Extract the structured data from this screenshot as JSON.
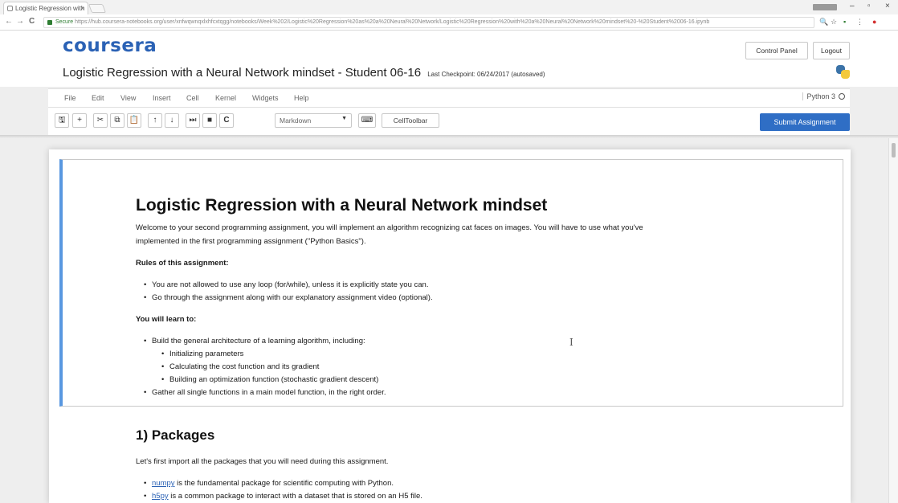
{
  "browser": {
    "tab_title": "Logistic Regression with",
    "tab_close": "×",
    "back": "←",
    "forward": "→",
    "reload": "C",
    "secure_label": "Secure",
    "url": "https://hub.coursera-notebooks.org/user/xnfwqwnqxlxhfcxtqgg/notebooks/Week%202/Logistic%20Regression%20as%20a%20Neural%20Network/Logistic%20Regression%20with%20a%20Neural%20Network%20mindset%20-%20Student%2006-16.ipynb",
    "window_minimize": "–",
    "window_restore": "▫",
    "window_close": "×"
  },
  "header": {
    "logo": "coursera",
    "notebook_title": "Logistic Regression with a Neural Network mindset - Student 06-16",
    "checkpoint": "Last Checkpoint: 06/24/2017 (autosaved)",
    "control_panel": "Control Panel",
    "logout": "Logout"
  },
  "menu": {
    "items": [
      "File",
      "Edit",
      "View",
      "Insert",
      "Cell",
      "Kernel",
      "Widgets",
      "Help"
    ],
    "kernel": "Python 3"
  },
  "toolbar": {
    "save": "🖫",
    "insert": "+",
    "cut": "✂",
    "copy": "⧉",
    "paste": "📋",
    "move_up": "↑",
    "move_down": "↓",
    "run": "⏭",
    "stop": "■",
    "restart": "C",
    "cell_type": "Markdown",
    "cell_type_caret": "▼",
    "keyboard": "⌨",
    "celltoolbar": "CellToolbar",
    "submit": "Submit Assignment"
  },
  "notebook": {
    "title": "Logistic Regression with a Neural Network mindset",
    "intro_1": "Welcome to your second programming assignment, you will implement an algorithm recognizing cat faces on images. You will have to use what you've",
    "intro_2": "implemented in the first programming assignment (\"Python Basics\").",
    "rules_heading": "Rules of this assignment:",
    "rules": [
      "You are not allowed to use any loop (for/while), unless it is explicitly state you can.",
      "Go through the assignment along with our explanatory assignment video (optional)."
    ],
    "learn_heading": "You will learn to:",
    "learn_1": "Build the general architecture of a learning algorithm, including:",
    "learn_sub": [
      "Initializing parameters",
      "Calculating the cost function and its gradient",
      "Building an optimization function (stochastic gradient descent)"
    ],
    "learn_2": "Gather all single functions in a main model function, in the right order.",
    "packages_heading": "1) Packages",
    "packages_intro": "Let's first import all the packages that you will need during this assignment.",
    "pkg_numpy_link": "numpy",
    "pkg_numpy_text": " is the fundamental package for scientific computing with Python.",
    "pkg_h5py_link": "h5py",
    "pkg_h5py_text": " is a common package to interact with a dataset that is stored on an H5 file.",
    "text_cursor": "I"
  }
}
